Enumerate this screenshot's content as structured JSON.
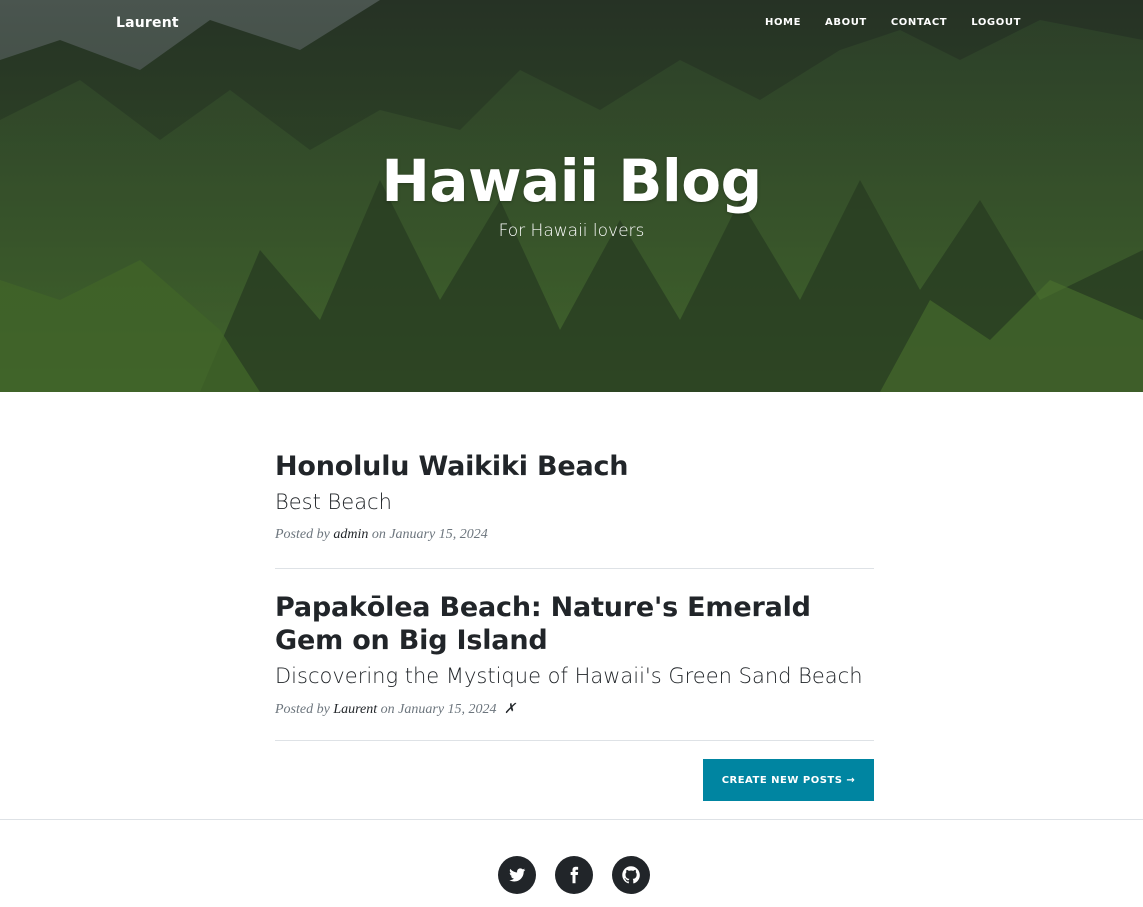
{
  "nav": {
    "brand": "Laurent",
    "links": [
      "HOME",
      "ABOUT",
      "CONTACT",
      "LOGOUT"
    ]
  },
  "header": {
    "title": "Hawaii Blog",
    "subtitle": "For Hawaii lovers"
  },
  "posts": [
    {
      "title": "Honolulu Waikiki Beach",
      "subtitle": "Best Beach",
      "posted_by": "Posted by",
      "author": "admin",
      "on": "on",
      "date": "January 15, 2024",
      "delete": ""
    },
    {
      "title": "Papakōlea Beach: Nature's Emerald Gem on Big Island",
      "subtitle": "Discovering the Mystique of Hawaii's Green Sand Beach",
      "posted_by": "Posted by",
      "author": "Laurent",
      "on": "on",
      "date": "January 15, 2024",
      "delete": "✗"
    }
  ],
  "create_button": "CREATE NEW POSTS →",
  "footer": {
    "social": [
      "twitter-icon",
      "facebook-icon",
      "github-icon"
    ]
  },
  "colors": {
    "accent": "#0085a1",
    "text": "#212529",
    "muted": "#6c757d"
  }
}
